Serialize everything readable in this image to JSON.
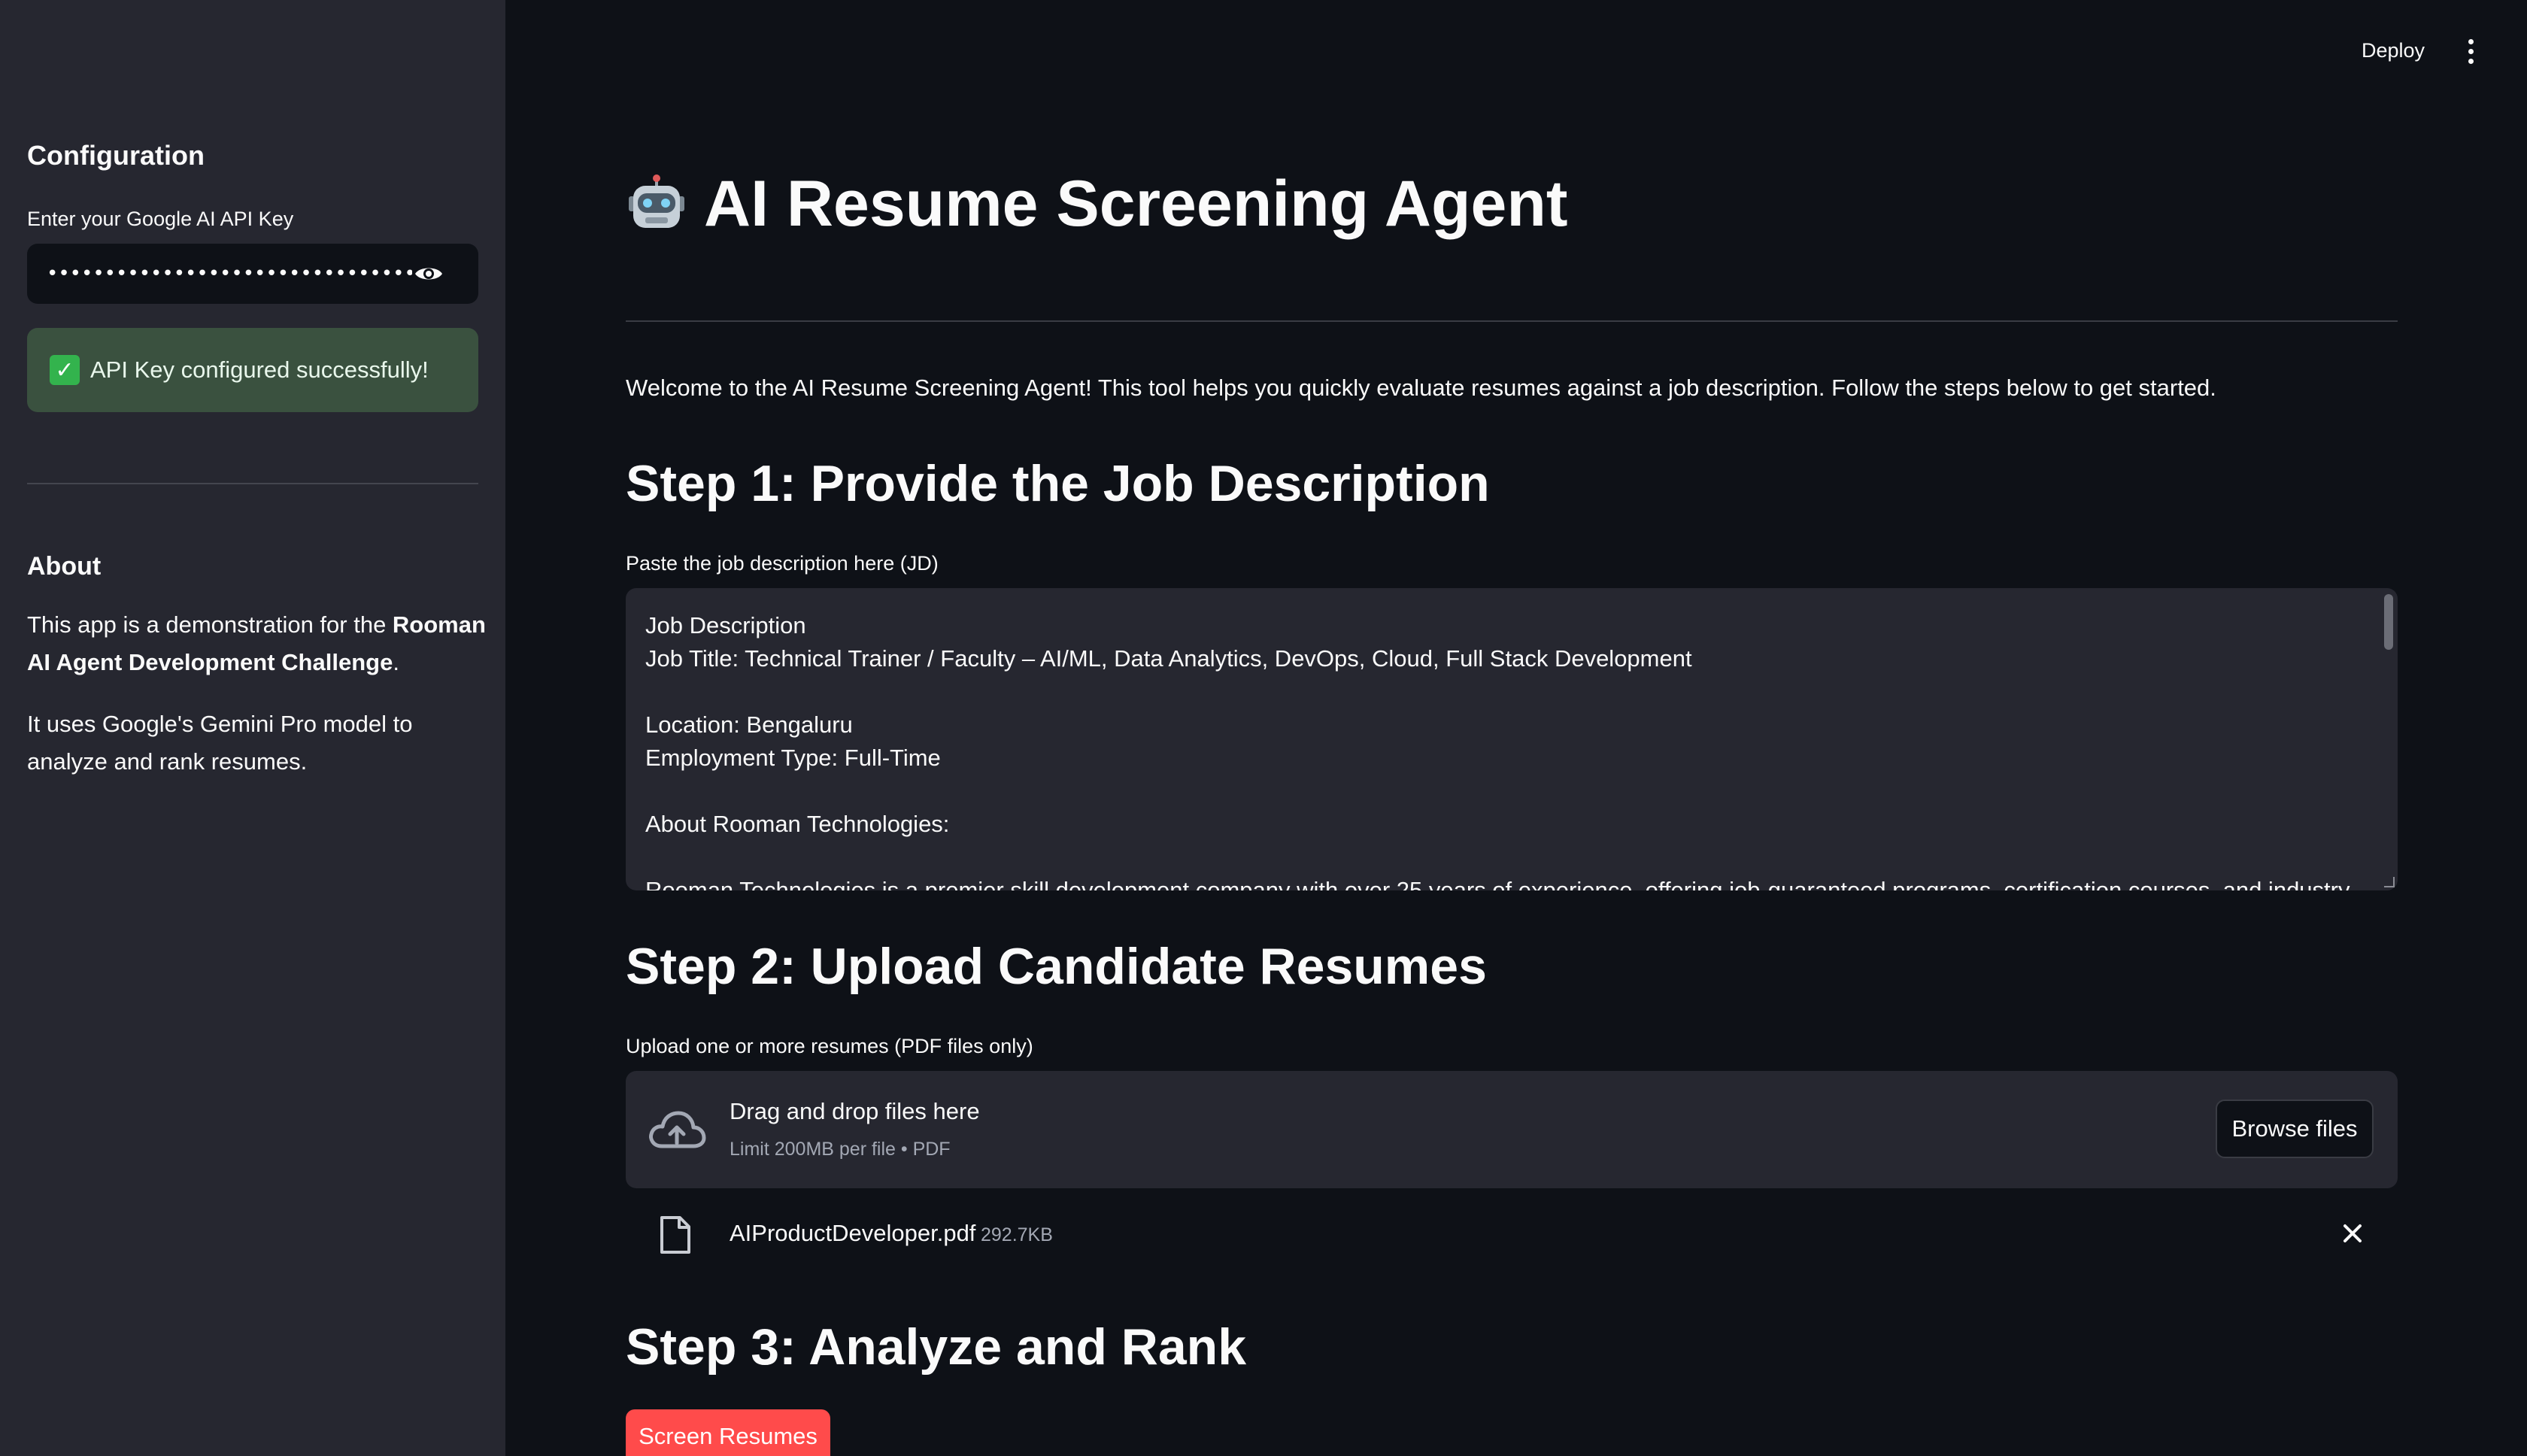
{
  "topbar": {
    "deploy_label": "Deploy",
    "menu_icon": "more-vertical-icon"
  },
  "sidebar": {
    "title": "Configuration",
    "api_key_label": "Enter your Google AI API Key",
    "api_key_value": "••••••••••••••••••••••••••••••••••••••",
    "success_message": "API Key configured successfully!",
    "about_title": "About",
    "about_p1_pre": "This app is a demonstration for the ",
    "about_p1_bold": "Rooman AI Agent Development Challenge",
    "about_p1_post": ".",
    "about_p2": "It uses Google's Gemini Pro model to analyze and rank resumes."
  },
  "main": {
    "title": "AI Resume Screening Agent",
    "welcome": "Welcome to the AI Resume Screening Agent! This tool helps you quickly evaluate resumes against a job description. Follow the steps below to get started.",
    "step1_title": "Step 1: Provide the Job Description",
    "jd_label": "Paste the job description here (JD)",
    "jd_lines": [
      "Job Description",
      "Job Title: Technical Trainer / Faculty – AI/ML, Data Analytics, DevOps, Cloud, Full Stack Development",
      "",
      "Location: Bengaluru",
      "Employment Type: Full-Time",
      "",
      "About Rooman Technologies:",
      "",
      "Rooman Technologies is a premier skill development company with over 25 years of experience, offering job-guaranteed programs, certification courses, and industry"
    ],
    "step2_title": "Step 2: Upload Candidate Resumes",
    "upload_label": "Upload one or more resumes (PDF files only)",
    "drag_text": "Drag and drop files here",
    "limit_text": "Limit 200MB per file • PDF",
    "browse_label": "Browse files",
    "file": {
      "name": "AIProductDeveloper.pdf",
      "size": "292.7KB"
    },
    "step3_title": "Step 3: Analyze and Rank",
    "screen_button": "Screen Resumes"
  },
  "colors": {
    "background": "#0e1117",
    "sidebar": "#262730",
    "primary": "#ff4b4b",
    "success_bg": "#3a513f"
  }
}
